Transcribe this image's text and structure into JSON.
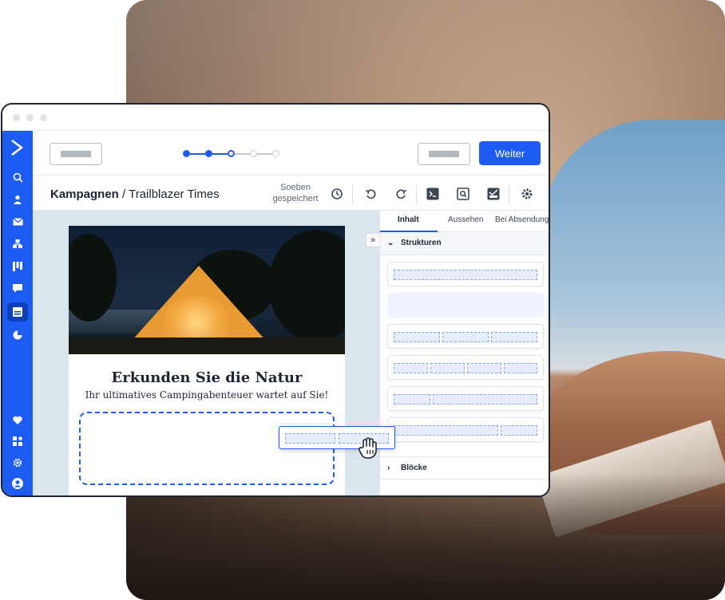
{
  "window": {
    "title": ""
  },
  "topbar": {
    "next_label": "Weiter"
  },
  "stepper": {
    "steps": [
      "done",
      "done",
      "current",
      "todo",
      "todo"
    ]
  },
  "header": {
    "breadcrumb_root": "Kampagnen",
    "breadcrumb_sep": " / ",
    "breadcrumb_current": "Trailblazer Times",
    "save_status": "Soeben gespeichert"
  },
  "email": {
    "title": "Erkunden Sie die Natur",
    "subtitle": "Ihr ultimatives Campingabenteuer wartet auf Sie!"
  },
  "panel": {
    "tabs": [
      "Inhalt",
      "Aussehen",
      "Bei Absendung"
    ],
    "section_structures": "Strukturen",
    "section_blocks": "Blöcke"
  },
  "colors": {
    "accent": "#1c5cf2",
    "rail": "#1c5cf2"
  }
}
